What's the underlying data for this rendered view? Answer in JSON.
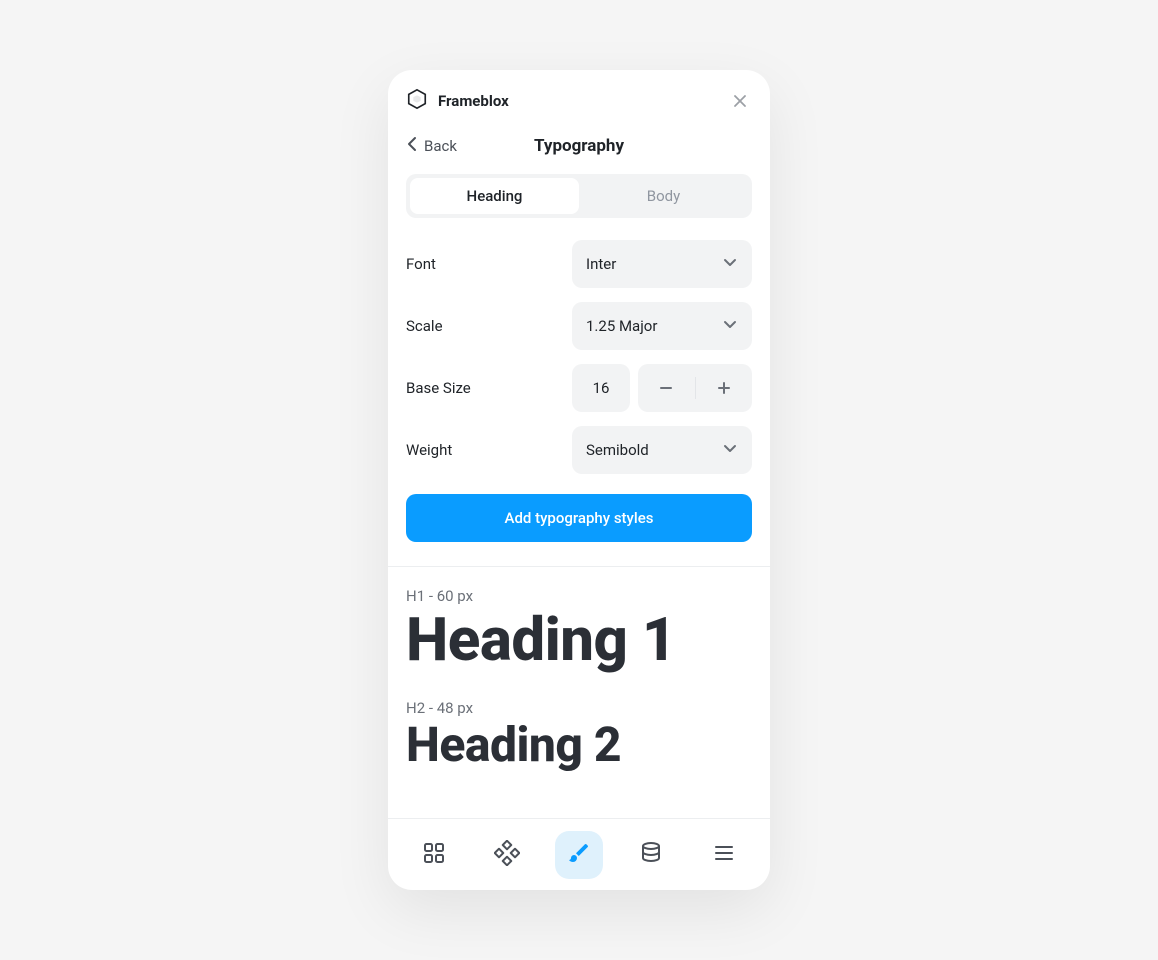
{
  "brand": {
    "name": "Frameblox"
  },
  "nav": {
    "back_label": "Back",
    "title": "Typography"
  },
  "tabs": {
    "heading": "Heading",
    "body": "Body"
  },
  "controls": {
    "font": {
      "label": "Font",
      "value": "Inter"
    },
    "scale": {
      "label": "Scale",
      "value": "1.25 Major"
    },
    "base_size": {
      "label": "Base Size",
      "value": "16"
    },
    "weight": {
      "label": "Weight",
      "value": "Semibold"
    }
  },
  "actions": {
    "add_styles": "Add typography styles"
  },
  "previews": {
    "h1": {
      "meta": "H1 - 60 px",
      "sample": "Heading 1"
    },
    "h2": {
      "meta": "H2 - 48 px",
      "sample": "Heading 2"
    }
  }
}
